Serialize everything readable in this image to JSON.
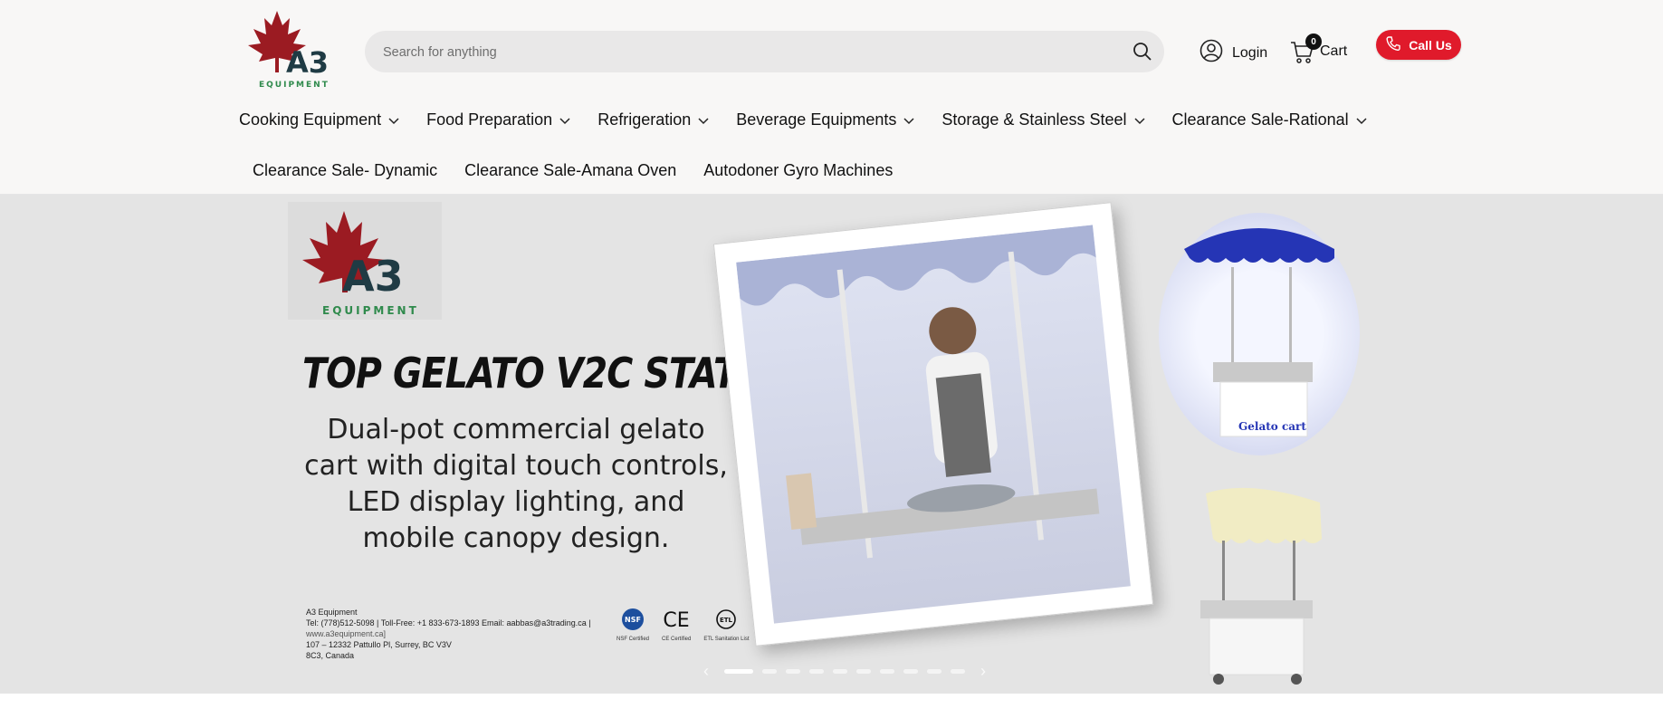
{
  "header": {
    "logo": {
      "brand": "A3",
      "sub": "EQUIPMENT"
    },
    "search": {
      "placeholder": "Search for anything"
    },
    "login_label": "Login",
    "cart": {
      "label": "Cart",
      "count": "0"
    },
    "call_label": "Call Us"
  },
  "nav": {
    "primary": [
      {
        "label": "Cooking Equipment"
      },
      {
        "label": "Food Preparation"
      },
      {
        "label": "Refrigeration"
      },
      {
        "label": "Beverage Equipments"
      },
      {
        "label": "Storage & Stainless Steel"
      },
      {
        "label": "Clearance Sale-Rational"
      }
    ],
    "secondary": [
      {
        "label": "Clearance Sale- Dynamic"
      },
      {
        "label": "Clearance Sale-Amana Oven"
      },
      {
        "label": "Autodoner Gyro Machines"
      }
    ]
  },
  "hero": {
    "logo": {
      "brand": "A3",
      "sub": "EQUIPMENT"
    },
    "title": "TOP GELATO V2C STATION",
    "subtitle": "Dual-pot commercial gelato cart with digital touch controls, LED display lighting, and mobile canopy design.",
    "contact": {
      "company": "A3 Equipment",
      "phones": "Tel: (778)512-5098 | Toll-Free: +1 833-673-1893 Email: aabbas@a3trading.ca |",
      "website": "www.a3equipment.ca]",
      "address1": "107 – 12332 Pattullo Pl, Surrey, BC V3V",
      "address2": "8C3, Canada"
    },
    "certs": [
      {
        "mark": "NSF",
        "label": "NSF Certified"
      },
      {
        "mark": "CE",
        "label": "CE Certified"
      },
      {
        "mark": "ETL",
        "label": "ETL Sanitation List"
      }
    ],
    "cart_label": "Gelato cart"
  },
  "carousel": {
    "slides": 10,
    "active": 1
  },
  "colors": {
    "accent": "#e01a2b",
    "brand_red": "#9b1b22",
    "brand_dark": "#1f3b44",
    "brand_green": "#2f8a4c"
  }
}
